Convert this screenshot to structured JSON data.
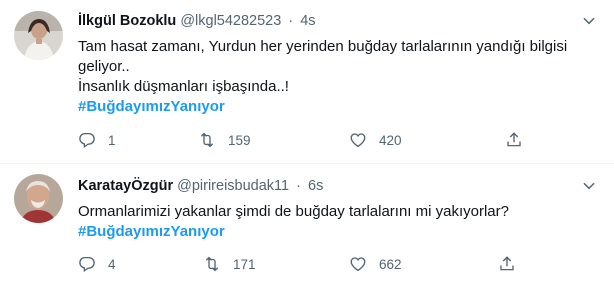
{
  "tweets": [
    {
      "name": "İlkgül Bozoklu",
      "handle": "@lkgl54282523",
      "separator": "·",
      "time": "4s",
      "lines": [
        "Tam hasat zamanı, Yurdun her yerinden buğday tarlalarının yandığı bilgisi",
        "geliyor..",
        "İnsanlık düşmanları işbaşında..!"
      ],
      "hashtag": "#BuğdayımızYanıyor",
      "replies": "1",
      "retweets": "159",
      "likes": "420"
    },
    {
      "name": "KaratayÖzgür",
      "handle": "@pirireisbudak11",
      "separator": "·",
      "time": "6s",
      "lines": [
        "Ormanlarimizi yakanlar şimdi de buğday tarlalarını mi yakıyorlar?"
      ],
      "hashtag": "#BuğdayımızYanıyor",
      "replies": "4",
      "retweets": "171",
      "likes": "662"
    }
  ],
  "colors": {
    "text": "#0f1419",
    "secondary": "#536471",
    "hashtag": "#1d9bf0",
    "divider": "#eff3f4"
  },
  "icons": [
    "more-icon",
    "reply-icon",
    "retweet-icon",
    "like-icon",
    "share-icon"
  ]
}
